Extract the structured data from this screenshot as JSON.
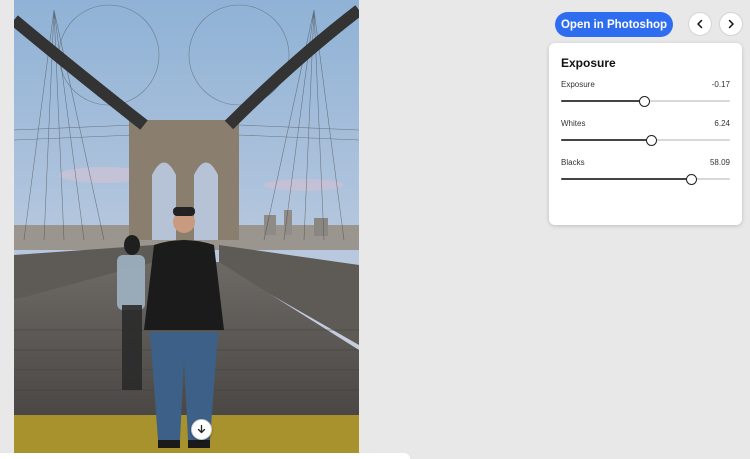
{
  "toolbar": {
    "open_label": "Open in Photoshop",
    "prev_icon": "chevron-left-icon",
    "next_icon": "chevron-right-icon",
    "accent_color": "#2f6df0"
  },
  "photo": {
    "download_icon": "arrow-down-icon"
  },
  "panel": {
    "title": "Exposure",
    "sliders": [
      {
        "label": "Exposure",
        "value": "-0.17",
        "fraction": 0.49
      },
      {
        "label": "Whites",
        "value": "6.24",
        "fraction": 0.53
      },
      {
        "label": "Blacks",
        "value": "58.09",
        "fraction": 0.77
      }
    ]
  }
}
